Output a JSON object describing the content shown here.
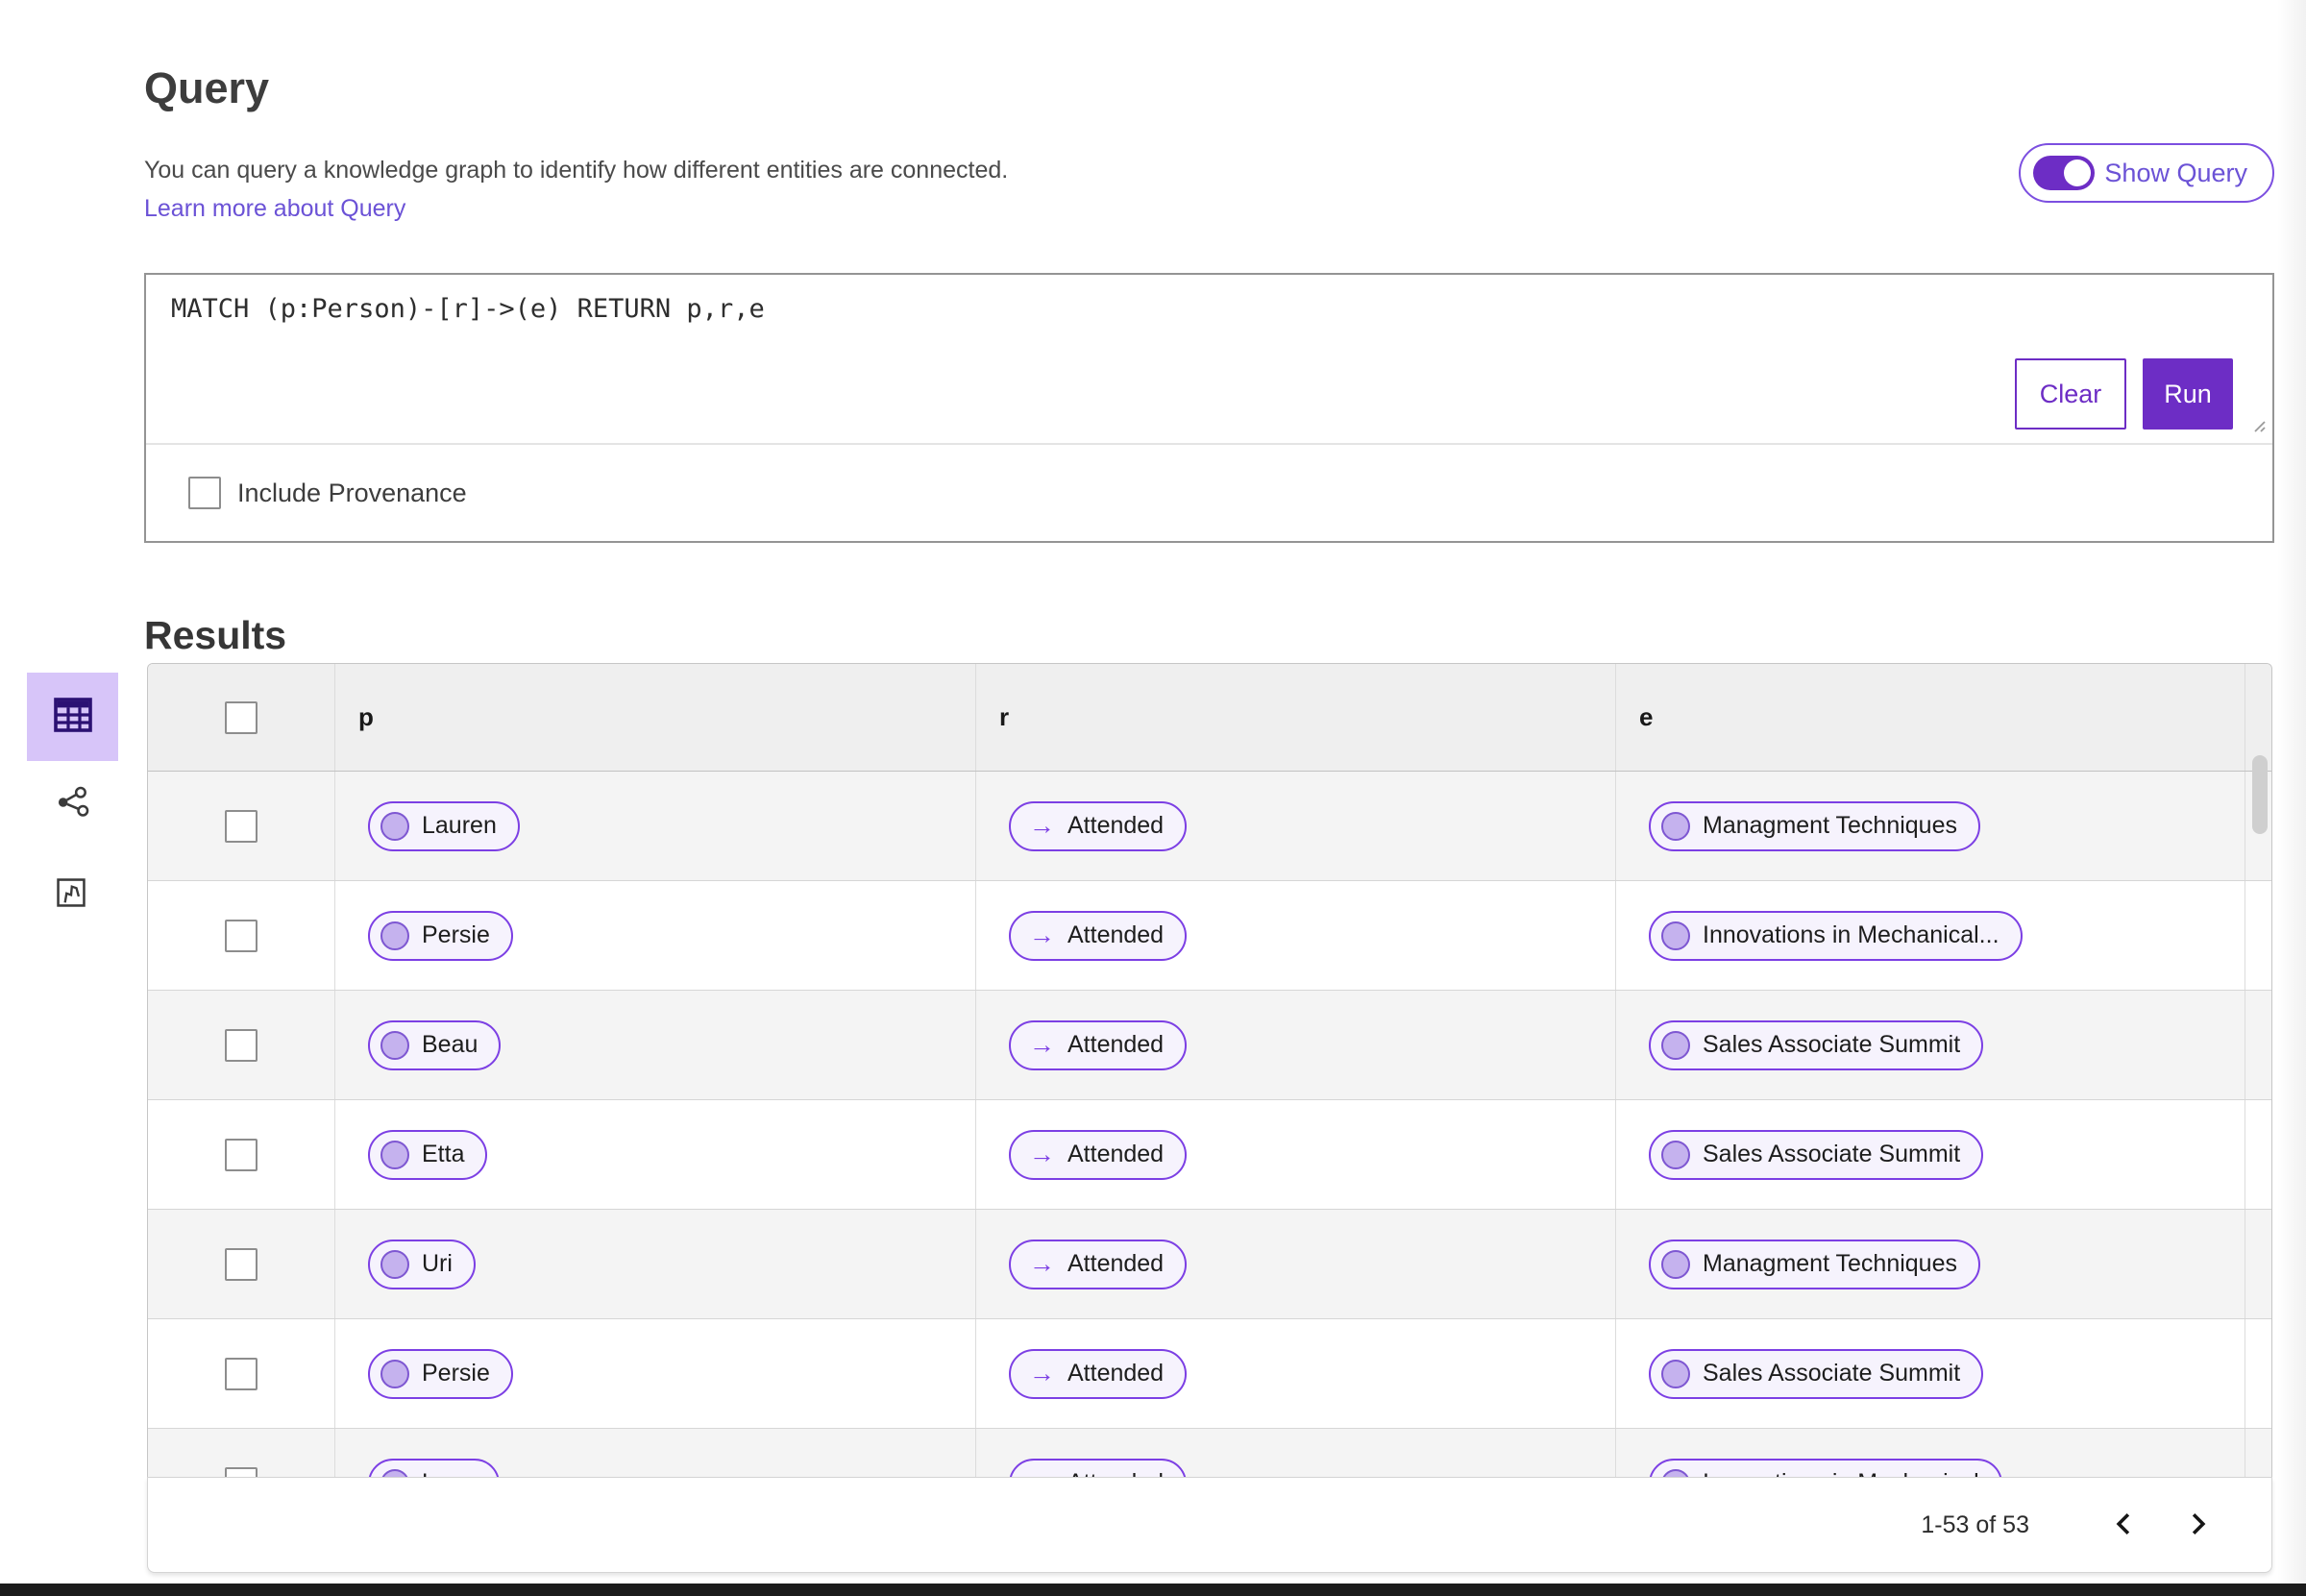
{
  "query_section": {
    "title": "Query",
    "description": "You can query a knowledge graph to identify how different entities are connected.",
    "learn_more_label": "Learn more about Query",
    "show_query_label": "Show Query",
    "query_text": "MATCH (p:Person)-[r]->(e) RETURN p,r,e",
    "include_provenance_label": "Include Provenance",
    "clear_label": "Clear",
    "run_label": "Run"
  },
  "results_section": {
    "title": "Results",
    "views": [
      {
        "icon": "table-view-icon",
        "selected": true
      },
      {
        "icon": "graph-view-icon",
        "selected": false
      },
      {
        "icon": "map-view-icon",
        "selected": false
      }
    ],
    "table": {
      "columns": [
        "p",
        "r",
        "e"
      ],
      "rows": [
        {
          "p": "Lauren",
          "r": "Attended",
          "e": "Managment Techniques"
        },
        {
          "p": "Persie",
          "r": "Attended",
          "e": "Innovations in Mechanical..."
        },
        {
          "p": "Beau",
          "r": "Attended",
          "e": "Sales Associate Summit"
        },
        {
          "p": "Etta",
          "r": "Attended",
          "e": "Sales Associate Summit"
        },
        {
          "p": "Uri",
          "r": "Attended",
          "e": "Managment Techniques"
        },
        {
          "p": "Persie",
          "r": "Attended",
          "e": "Sales Associate Summit"
        },
        {
          "p": "Larry",
          "r": "Attended",
          "e": "Innovations in Mechanical"
        }
      ]
    },
    "pagination": {
      "range_label": "1-53 of 53"
    }
  },
  "icons": {
    "arrow_right": "→"
  },
  "colors": {
    "accent_purple": "#6d2dc5",
    "pill_border": "#7c3fe4",
    "pill_bg": "#f6f3fd",
    "selected_view_bg": "#d7c5f9",
    "link": "#6b52d6",
    "header_bg": "#efefef",
    "row_alt_bg": "#f4f4f4"
  }
}
